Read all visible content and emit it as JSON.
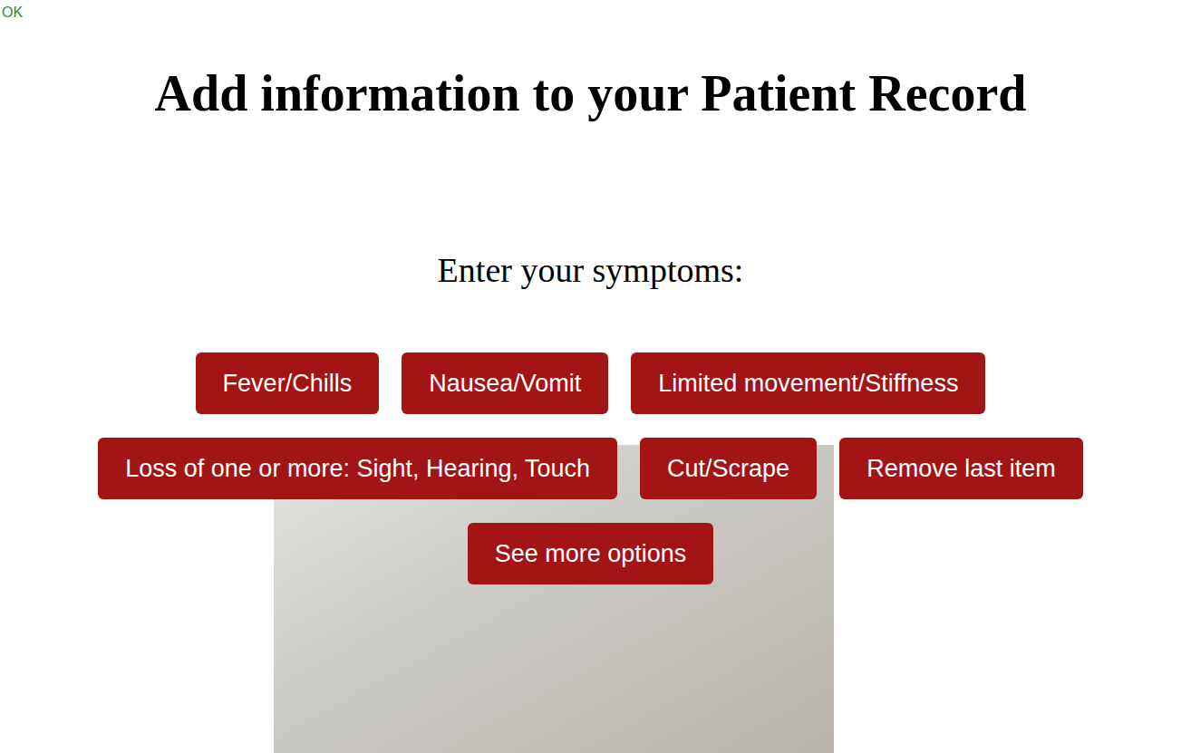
{
  "status": "OK",
  "title": "Add information to your Patient Record",
  "prompt": "Enter your symptoms:",
  "buttons": [
    "Fever/Chills",
    "Nausea/Vomit",
    "Limited movement/Stiffness",
    "Loss of one or more: Sight, Hearing, Touch",
    "Cut/Scrape",
    "Remove last item",
    "See more options"
  ]
}
